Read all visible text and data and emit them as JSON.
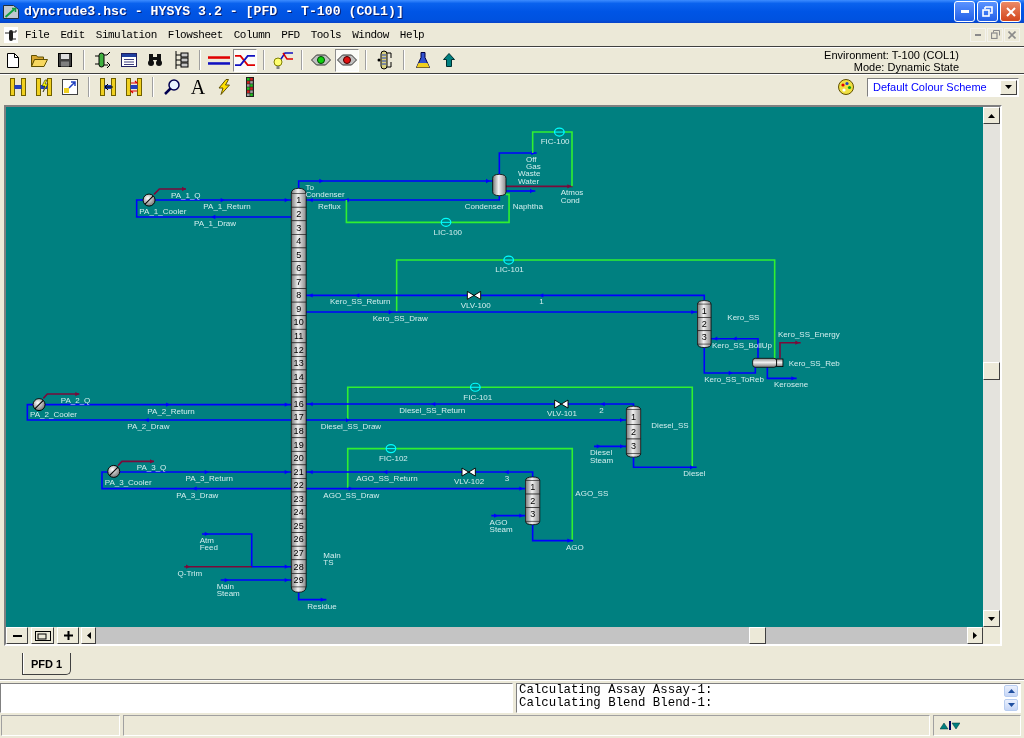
{
  "window": {
    "title": "dyncrude3.hsc - HYSYS 3.2 - [PFD - T-100 (COL1)]"
  },
  "menu": [
    "File",
    "Edit",
    "Simulation",
    "Flowsheet",
    "Column",
    "PFD",
    "Tools",
    "Window",
    "Help"
  ],
  "toolbar": [
    {
      "pressed": false
    },
    {
      "pressed": false
    },
    {
      "pressed": false
    },
    {
      "pressed": false
    },
    {
      "pressed": false
    },
    {
      "pressed": false
    },
    {
      "pressed": false
    },
    {
      "pressed": false
    },
    {
      "pressed": true
    },
    {
      "pressed": false
    },
    {
      "pressed": false
    },
    {
      "pressed": true
    },
    {
      "pressed": false
    },
    {
      "pressed": false
    },
    {
      "pressed": false
    }
  ],
  "environment": {
    "environment": "Environment: T-100 (COL1)",
    "mode": "Mode: Dynamic State"
  },
  "toolbar_2": {
    "text_tool": "A"
  },
  "colour_scheme": {
    "value": "Default Colour Scheme"
  },
  "pfd": {
    "column": {
      "stages": [
        "1",
        "2",
        "3",
        "4",
        "5",
        "6",
        "7",
        "8",
        "9",
        "10",
        "11",
        "12",
        "13",
        "14",
        "15",
        "16",
        "17",
        "18",
        "19",
        "20",
        "21",
        "22",
        "23",
        "24",
        "25",
        "26",
        "27",
        "28",
        "29"
      ]
    },
    "strippers": [
      {
        "stages": [
          "1",
          "2",
          "3"
        ]
      },
      {
        "stages": [
          "1",
          "2",
          "3"
        ]
      },
      {
        "stages": [
          "1",
          "2",
          "3"
        ]
      }
    ],
    "units": [
      "PA_1_Cooler",
      "Condenser",
      "Kero_SS",
      "Kero_SS_Reb",
      "PA_2_Cooler",
      "Diesel_SS",
      "PA_3_Cooler",
      "AGO_SS",
      "Main TS"
    ],
    "controllers": [
      "FIC-100",
      "LIC-100",
      "LIC-101",
      "FIC-101",
      "FIC-102"
    ],
    "valves": [
      "VLV-100",
      "VLV-101",
      "VLV-102"
    ],
    "streams": [
      "To Condenser",
      "Off Gas",
      "Waste Water",
      "Atmos Cond",
      "PA_1_Q",
      "PA_1_Return",
      "Reflux",
      "Naphtha",
      "PA_1_Draw",
      "Kero_SS_Return",
      "1",
      "Kero_SS_Draw",
      "Kero_SS_Energy",
      "Kero_SS_BoilUp",
      "Kero_SS_ToReb",
      "Kerosene",
      "PA_2_Q",
      "PA_2_Return",
      "Diesel_SS_Return",
      "2",
      "PA_2_Draw",
      "Diesel_SS_Draw",
      "Diesel Steam",
      "PA_3_Q",
      "Diesel",
      "PA_3_Return",
      "AGO_SS_Return",
      "3",
      "PA_3_Draw",
      "AGO_SS_Draw",
      "AGO Steam",
      "Atm Feed",
      "AGO",
      "Q-Trim",
      "Main Steam",
      "Residue"
    ]
  },
  "tabs": [
    {
      "label": "PFD 1",
      "selected": true
    }
  ],
  "trace": [
    "Calculating Assay Assay-1:",
    "Calculating Blend Blend-1:"
  ]
}
